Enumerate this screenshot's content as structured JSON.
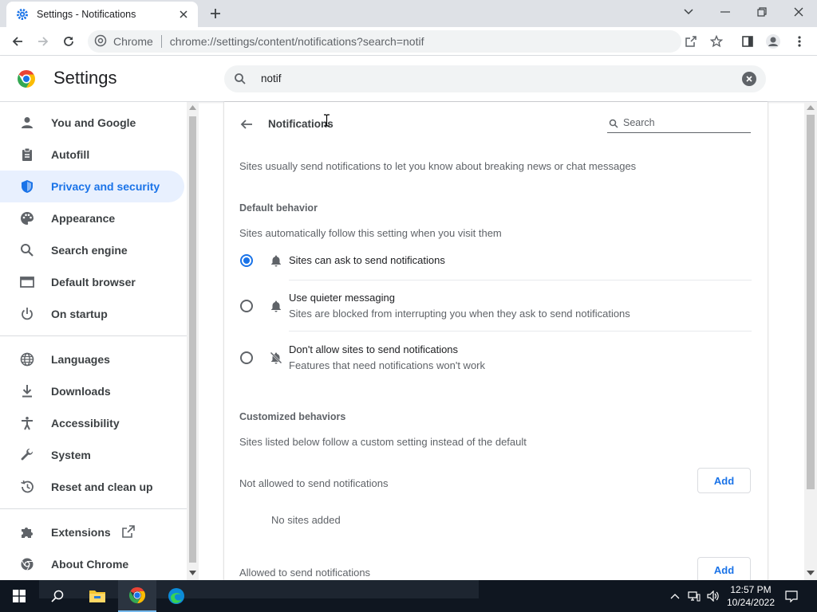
{
  "browser": {
    "tab_title": "Settings - Notifications",
    "site_chip": "Chrome",
    "url": "chrome://settings/content/notifications?search=notif"
  },
  "settings_header": {
    "title": "Settings",
    "search_value": "notif"
  },
  "sidebar": {
    "items": [
      {
        "label": "You and Google",
        "icon": "person-icon"
      },
      {
        "label": "Autofill",
        "icon": "clipboard-icon"
      },
      {
        "label": "Privacy and security",
        "icon": "shield-icon",
        "active": true
      },
      {
        "label": "Appearance",
        "icon": "palette-icon"
      },
      {
        "label": "Search engine",
        "icon": "search-icon"
      },
      {
        "label": "Default browser",
        "icon": "browser-icon"
      },
      {
        "label": "On startup",
        "icon": "power-icon"
      },
      {
        "label": "Languages",
        "icon": "globe-icon"
      },
      {
        "label": "Downloads",
        "icon": "download-icon"
      },
      {
        "label": "Accessibility",
        "icon": "accessibility-icon"
      },
      {
        "label": "System",
        "icon": "wrench-icon"
      },
      {
        "label": "Reset and clean up",
        "icon": "history-icon"
      },
      {
        "label": "Extensions",
        "icon": "puzzle-icon"
      },
      {
        "label": "About Chrome",
        "icon": "chrome-icon"
      }
    ]
  },
  "page": {
    "title": "Notifications",
    "search_placeholder": "Search",
    "intro": "Sites usually send notifications to let you know about breaking news or chat messages",
    "default_behavior": {
      "heading": "Default behavior",
      "description": "Sites automatically follow this setting when you visit them",
      "options": [
        {
          "label": "Sites can ask to send notifications",
          "sublabel": "",
          "selected": true
        },
        {
          "label": "Use quieter messaging",
          "sublabel": "Sites are blocked from interrupting you when they ask to send notifications",
          "selected": false
        },
        {
          "label": "Don't allow sites to send notifications",
          "sublabel": "Features that need notifications won't work",
          "selected": false
        }
      ]
    },
    "customized": {
      "heading": "Customized behaviors",
      "description": "Sites listed below follow a custom setting instead of the default",
      "not_allowed_label": "Not allowed to send notifications",
      "not_allowed_empty": "No sites added",
      "allowed_label": "Allowed to send notifications",
      "add_label": "Add"
    }
  },
  "taskbar": {
    "time": "12:57 PM",
    "date": "10/24/2022"
  },
  "colors": {
    "accent": "#1a73e8",
    "active_nav_bg": "#e8f0fe",
    "taskbar": "#0f1620"
  }
}
